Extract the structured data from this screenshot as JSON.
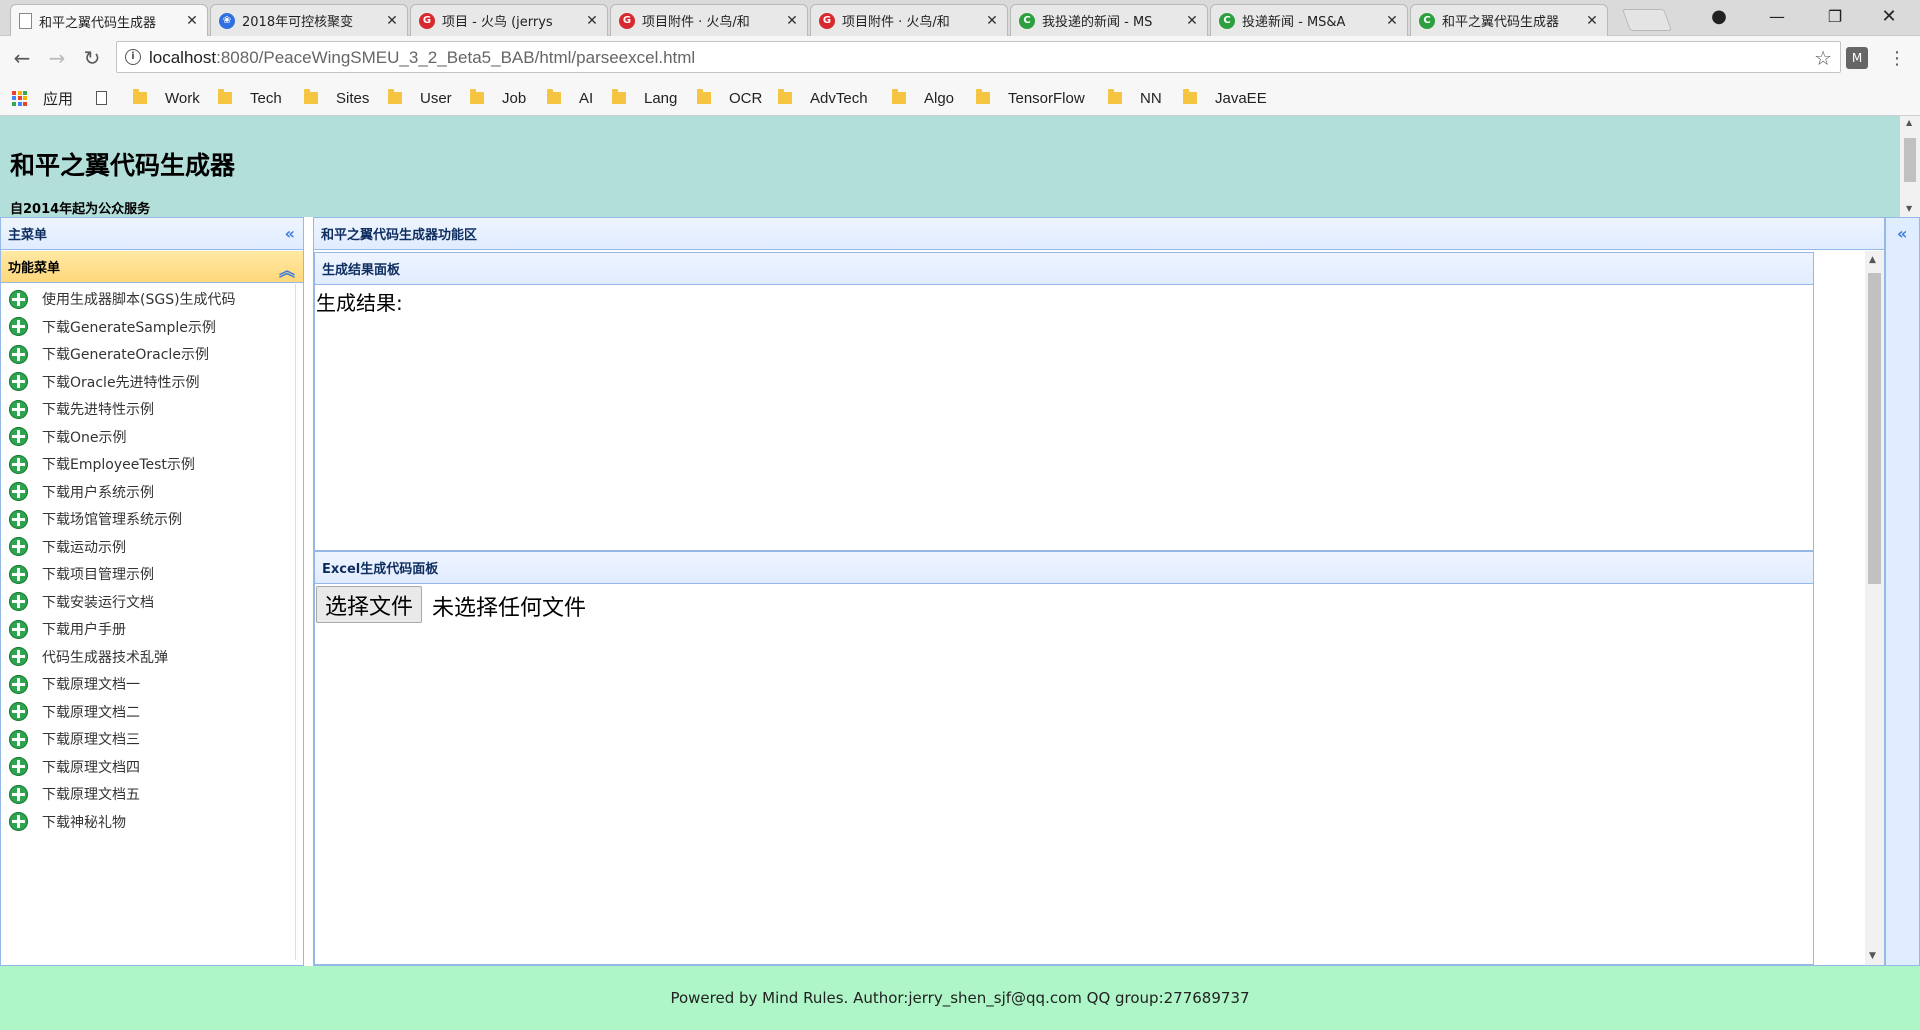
{
  "browser": {
    "tabs": [
      {
        "title": "和平之翼代码生成器",
        "favicon": "page-icon",
        "active": true
      },
      {
        "title": "2018年可控核聚变",
        "favicon": "baidu-paw-icon",
        "active": false
      },
      {
        "title": "项目 - 火鸟 (jerrys",
        "favicon": "gitee-icon",
        "active": false
      },
      {
        "title": "项目附件 · 火鸟/和",
        "favicon": "gitee-icon",
        "active": false
      },
      {
        "title": "项目附件 · 火鸟/和",
        "favicon": "gitee-icon",
        "active": false
      },
      {
        "title": "我投递的新闻 - MS",
        "favicon": "cnblogs-icon",
        "active": false
      },
      {
        "title": "投递新闻 - MS&A",
        "favicon": "cnblogs-icon",
        "active": false
      },
      {
        "title": "和平之翼代码生成器",
        "favicon": "cnblogs-icon",
        "active": false
      }
    ],
    "url_host": "localhost",
    "url_rest": ":8080/PeaceWingSMEU_3_2_Beta5_BAB/html/parseexcel.html",
    "bookmarks": {
      "apps_label": "应用",
      "folders": [
        "Work",
        "Tech",
        "Sites",
        "User",
        "Job",
        "AI",
        "Lang",
        "OCR",
        "AdvTech",
        "Algo",
        "TensorFlow",
        "NN",
        "JavaEE"
      ]
    }
  },
  "header": {
    "title": "和平之翼代码生成器",
    "subtitle": "自2014年起为公众服务"
  },
  "west": {
    "main_menu_title": "主菜单",
    "func_menu_title": "功能菜单",
    "items": [
      "使用生成器脚本(SGS)生成代码",
      "下载GenerateSample示例",
      "下载GenerateOracle示例",
      "下载Oracle先进特性示例",
      "下载先进特性示例",
      "下载One示例",
      "下载EmployeeTest示例",
      "下载用户系统示例",
      "下载场馆管理系统示例",
      "下载运动示例",
      "下载项目管理示例",
      "下载安装运行文档",
      "下载用户手册",
      "代码生成器技术乱弹",
      "下载原理文档一",
      "下载原理文档二",
      "下载原理文档三",
      "下载原理文档四",
      "下载原理文档五",
      "下载神秘礼物"
    ]
  },
  "center": {
    "title": "和平之翼代码生成器功能区",
    "result_panel_title": "生成结果面板",
    "result_label": "生成结果:",
    "excel_panel_title": "Excel生成代码面板",
    "file_button": "选择文件",
    "file_status": "未选择任何文件"
  },
  "footer": {
    "text": "Powered by Mind Rules. Author:jerry_shen_sjf@qq.com QQ group:277689737"
  },
  "colors": {
    "header_bg": "#b3dfda",
    "footer_bg": "#aef5c8",
    "panel_border": "#95b8e7",
    "func_header_bg": "#ffd77b",
    "plus_icon": "#2ea44f"
  }
}
